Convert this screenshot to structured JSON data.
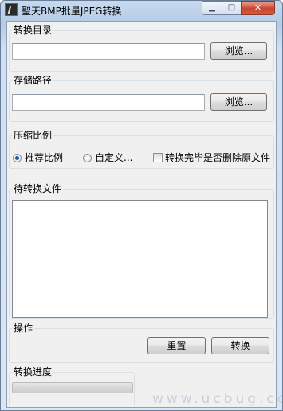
{
  "window": {
    "title": "聖天BMP批量JPEG转换",
    "minimize_glyph": "▁",
    "maximize_glyph": "□",
    "close_glyph": "✕"
  },
  "convert_dir": {
    "label": "转换目录",
    "value": "",
    "browse_label": "浏览..."
  },
  "save_path": {
    "label": "存储路径",
    "value": "",
    "browse_label": "浏览..."
  },
  "compression": {
    "label": "压缩比例",
    "options": [
      {
        "label": "推荐比例",
        "selected": true
      },
      {
        "label": "自定义...",
        "selected": false
      }
    ],
    "delete_after_label": "转换完毕是否删除原文件",
    "delete_after_checked": false
  },
  "pending_files": {
    "label": "待转换文件",
    "items": []
  },
  "actions": {
    "label": "操作",
    "reset_label": "重置",
    "convert_label": "转换"
  },
  "progress": {
    "label": "转换进度",
    "value": 0
  },
  "watermark": "www.ucbug.cc"
}
